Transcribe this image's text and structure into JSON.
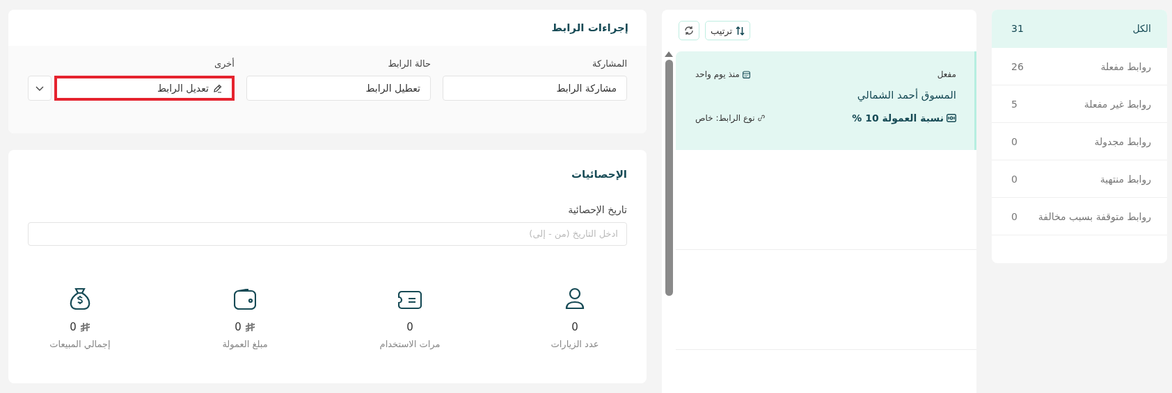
{
  "filters": [
    {
      "label": "الكل",
      "count": "31",
      "selected": true
    },
    {
      "label": "روابط مفعلة",
      "count": "26",
      "selected": false
    },
    {
      "label": "روابط غير مفعلة",
      "count": "5",
      "selected": false
    },
    {
      "label": "روابط مجدولة",
      "count": "0",
      "selected": false
    },
    {
      "label": "روابط منتهية",
      "count": "0",
      "selected": false
    },
    {
      "label": "روابط متوقفة بسبب مخالفة",
      "count": "0",
      "selected": false
    }
  ],
  "links_toolbar": {
    "sort_label": "ترتيب"
  },
  "links": [
    {
      "status": "مفعل",
      "date": "منذ يوم واحد",
      "name": "المسوق أحمد الشمالي",
      "commission": "نسبة العمولة 10 %",
      "link_type": "نوع الرابط: خاص",
      "selected": true
    }
  ],
  "actions": {
    "title": "إجراءات الرابط",
    "groups": [
      {
        "label": "المشاركة",
        "button": "مشاركة الرابط",
        "kind": "plain",
        "highlighted": false
      },
      {
        "label": "حالة الرابط",
        "button": "تعطيل الرابط",
        "kind": "plain",
        "highlighted": false
      },
      {
        "label": "أخرى",
        "button": "تعديل الرابط",
        "kind": "edit-menu",
        "highlighted": true
      }
    ]
  },
  "statistics": {
    "title": "الإحصائيات",
    "date_label": "تاريخ الإحصائية",
    "date_placeholder": "ادخل التاريخ (من - إلى)",
    "items": [
      {
        "label": "عدد الزيارات",
        "value": "0",
        "currency": false
      },
      {
        "label": "مرات الاستخدام",
        "value": "0",
        "currency": false
      },
      {
        "label": "مبلغ العمولة",
        "value": "0",
        "currency": true
      },
      {
        "label": "إجمالي المبيعات",
        "value": "0",
        "currency": true
      }
    ]
  }
}
